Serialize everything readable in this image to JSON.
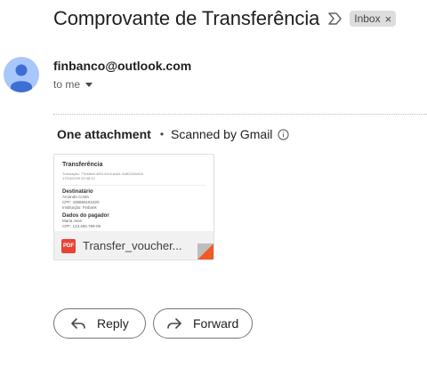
{
  "email": {
    "subject": "Comprovante de Transferência",
    "label": "Inbox",
    "label_remove": "×",
    "sender": "finbanco@outlook.com",
    "recipient": "to me"
  },
  "attachments": {
    "count_label": "One attachment",
    "separator": "•",
    "scan_status": "Scanned by Gmail",
    "items": [
      {
        "filename": "Transfer_voucher...",
        "type_badge": "PDF",
        "preview": {
          "title": "Transferência",
          "meta": [
            "Transação: 77bb8e8-4f49-41c4-bde1-4aff1248c61e",
            "17/04/2025 20:48:12"
          ],
          "recipient_heading": "Destinatário",
          "recipient_lines": [
            "Amanda Costa",
            "CPF: 438856181820",
            "Instituição: Finbank"
          ],
          "payer_heading": "Dados do pagador",
          "payer_lines": [
            "Maria José",
            "CPF: 123.456.789-09"
          ]
        }
      }
    ]
  },
  "actions": {
    "reply_label": "Reply",
    "forward_label": "Forward"
  },
  "colors": {
    "avatar_bg": "#a8c7fa",
    "avatar_fg": "#3c6ed4",
    "pdf_red": "#e94335",
    "chip_bg": "#dddddd"
  }
}
